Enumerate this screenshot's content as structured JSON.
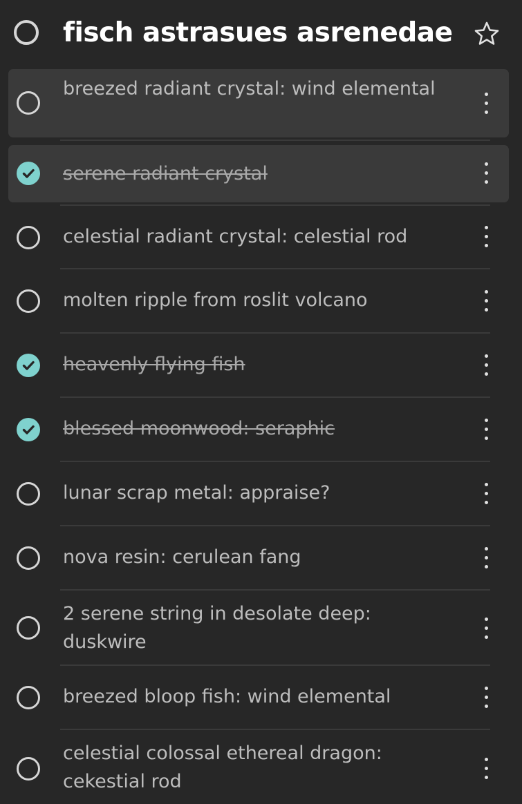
{
  "list": {
    "title": "fisch astrasues asrenedae"
  },
  "tasks": [
    {
      "label": "breezed radiant crystal: wind elemental",
      "completed": false,
      "selected": true
    },
    {
      "label": "serene radiant crystal",
      "completed": true,
      "selected": true
    },
    {
      "label": "celestial radiant crystal: celestial rod",
      "completed": false,
      "selected": false
    },
    {
      "label": "molten ripple from roslit volcano",
      "completed": false,
      "selected": false
    },
    {
      "label": "heavenly flying fish",
      "completed": true,
      "selected": false
    },
    {
      "label": "blessed moonwood: seraphic",
      "completed": true,
      "selected": false
    },
    {
      "label": "lunar scrap metal: appraise?",
      "completed": false,
      "selected": false
    },
    {
      "label": "nova resin: cerulean fang",
      "completed": false,
      "selected": false
    },
    {
      "label": "2 serene string in desolate deep: duskwire",
      "completed": false,
      "selected": false
    },
    {
      "label": "breezed bloop fish: wind elemental",
      "completed": false,
      "selected": false
    },
    {
      "label": "celestial colossal ethereal dragon: cekestial rod",
      "completed": false,
      "selected": false
    }
  ],
  "icons": {
    "list_circle": "circle-outline-icon",
    "favorite": "star-outline-icon",
    "task_open": "circle-outline-icon",
    "task_done": "check-circle-icon",
    "more": "more-vertical-icon"
  },
  "colors": {
    "background": "#272727",
    "selected_row": "#3a3a3a",
    "check_accent": "#7fd2ce",
    "text": "#bdbdbd",
    "title": "#ffffff"
  }
}
